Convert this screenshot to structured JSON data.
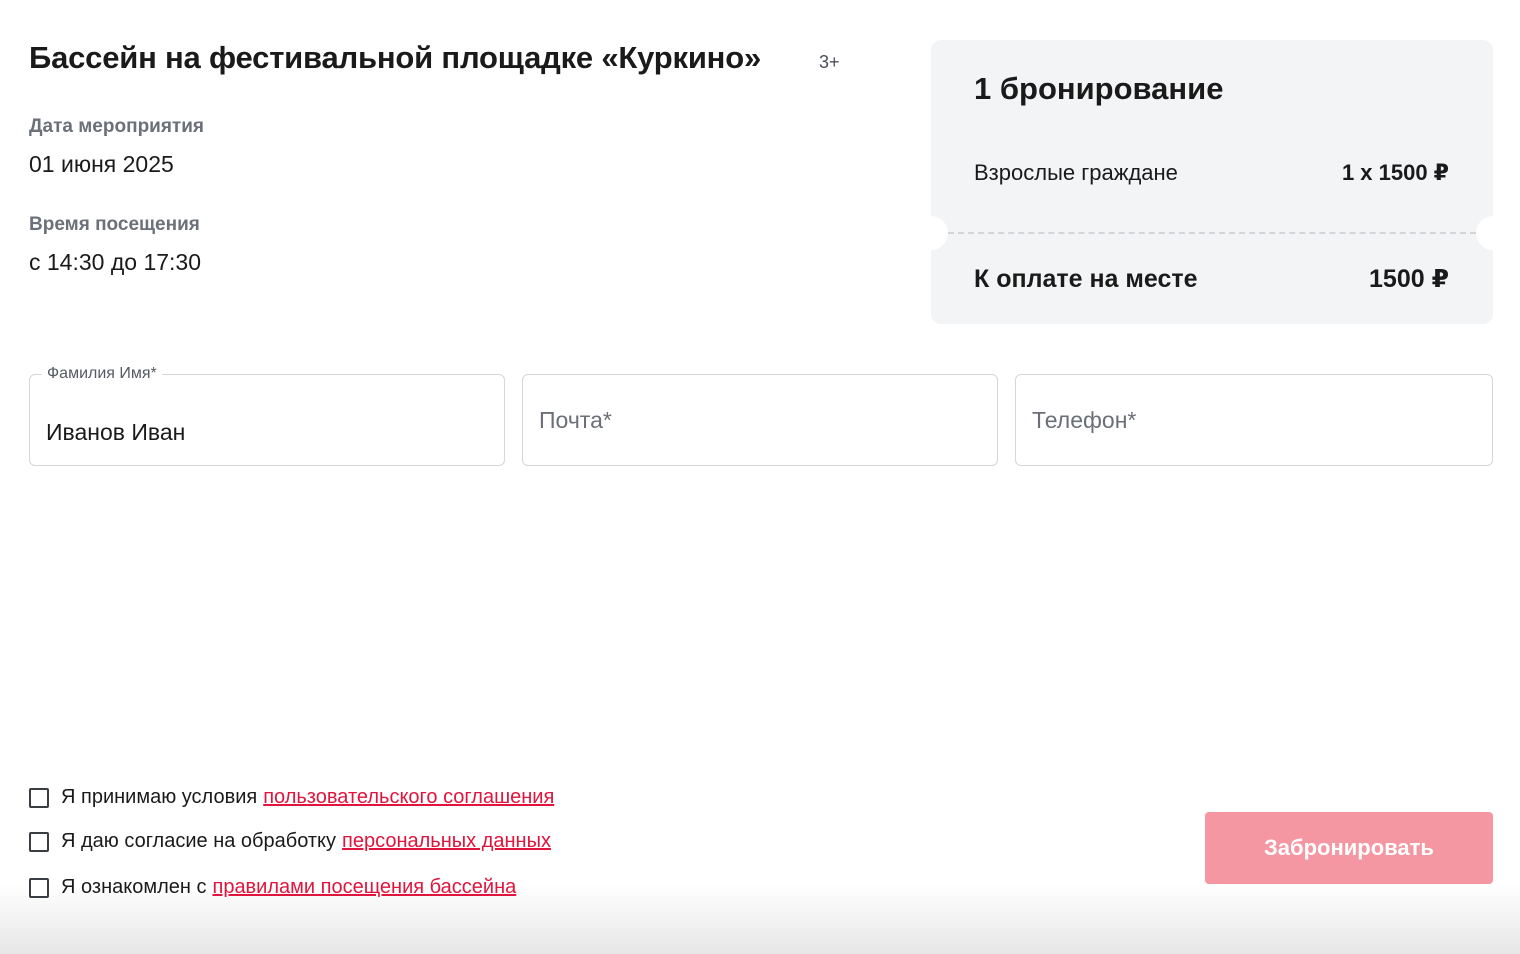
{
  "event": {
    "title": "Бассейн на фестивальной площадке «Куркино»",
    "age_rating": "3+",
    "date_label": "Дата мероприятия",
    "date_value": "01 июня 2025",
    "time_label": "Время посещения",
    "time_value": "с 14:30 до 17:30"
  },
  "summary": {
    "title": "1 бронирование",
    "ticket_type": "Взрослые граждане",
    "ticket_price": "1 х 1500 ₽",
    "total_label": "К оплате на месте",
    "total_value": "1500 ₽"
  },
  "form": {
    "name": {
      "label": "Фамилия Имя*",
      "value": "Иванов Иван"
    },
    "email": {
      "placeholder": "Почта*",
      "value": ""
    },
    "phone": {
      "placeholder": "Телефон*",
      "value": ""
    }
  },
  "consents": [
    {
      "text": "Я принимаю условия",
      "link": "пользовательского соглашения",
      "checked": false
    },
    {
      "text": "Я даю согласие на обработку",
      "link": "персональных данных",
      "checked": false
    },
    {
      "text": "Я ознакомлен с",
      "link": "правилами посещения бассейна",
      "checked": false
    }
  ],
  "submit_label": "Забронировать",
  "colors": {
    "accent": "#e0143c",
    "button_disabled": "#f596a3",
    "summary_bg": "#f3f4f6"
  }
}
